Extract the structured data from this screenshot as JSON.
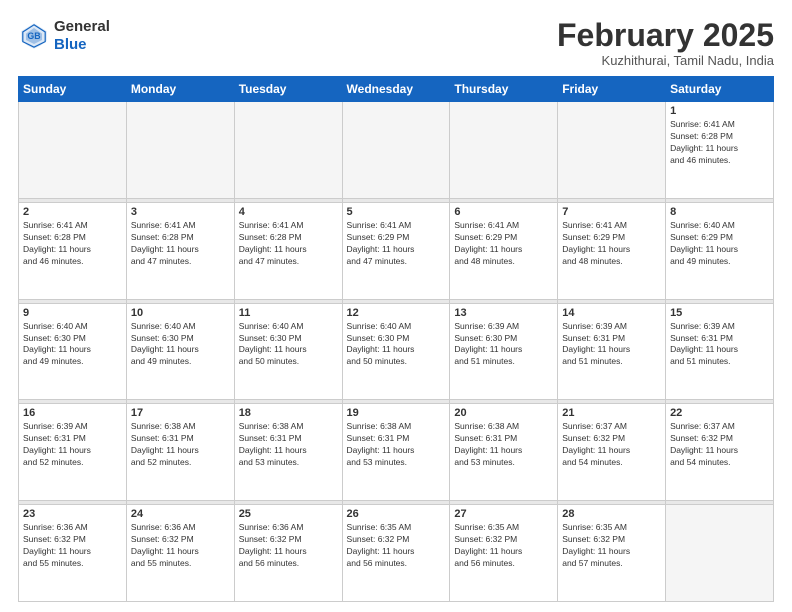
{
  "header": {
    "logo_general": "General",
    "logo_blue": "Blue",
    "title": "February 2025",
    "location": "Kuzhithurai, Tamil Nadu, India"
  },
  "calendar": {
    "days_of_week": [
      "Sunday",
      "Monday",
      "Tuesday",
      "Wednesday",
      "Thursday",
      "Friday",
      "Saturday"
    ],
    "weeks": [
      {
        "days": [
          {
            "num": "",
            "info": "",
            "empty": true
          },
          {
            "num": "",
            "info": "",
            "empty": true
          },
          {
            "num": "",
            "info": "",
            "empty": true
          },
          {
            "num": "",
            "info": "",
            "empty": true
          },
          {
            "num": "",
            "info": "",
            "empty": true
          },
          {
            "num": "",
            "info": "",
            "empty": true
          },
          {
            "num": "1",
            "info": "Sunrise: 6:41 AM\nSunset: 6:28 PM\nDaylight: 11 hours\nand 46 minutes.",
            "empty": false
          }
        ]
      },
      {
        "days": [
          {
            "num": "2",
            "info": "Sunrise: 6:41 AM\nSunset: 6:28 PM\nDaylight: 11 hours\nand 46 minutes.",
            "empty": false
          },
          {
            "num": "3",
            "info": "Sunrise: 6:41 AM\nSunset: 6:28 PM\nDaylight: 11 hours\nand 47 minutes.",
            "empty": false
          },
          {
            "num": "4",
            "info": "Sunrise: 6:41 AM\nSunset: 6:28 PM\nDaylight: 11 hours\nand 47 minutes.",
            "empty": false
          },
          {
            "num": "5",
            "info": "Sunrise: 6:41 AM\nSunset: 6:29 PM\nDaylight: 11 hours\nand 47 minutes.",
            "empty": false
          },
          {
            "num": "6",
            "info": "Sunrise: 6:41 AM\nSunset: 6:29 PM\nDaylight: 11 hours\nand 48 minutes.",
            "empty": false
          },
          {
            "num": "7",
            "info": "Sunrise: 6:41 AM\nSunset: 6:29 PM\nDaylight: 11 hours\nand 48 minutes.",
            "empty": false
          },
          {
            "num": "8",
            "info": "Sunrise: 6:40 AM\nSunset: 6:29 PM\nDaylight: 11 hours\nand 49 minutes.",
            "empty": false
          }
        ]
      },
      {
        "days": [
          {
            "num": "9",
            "info": "Sunrise: 6:40 AM\nSunset: 6:30 PM\nDaylight: 11 hours\nand 49 minutes.",
            "empty": false
          },
          {
            "num": "10",
            "info": "Sunrise: 6:40 AM\nSunset: 6:30 PM\nDaylight: 11 hours\nand 49 minutes.",
            "empty": false
          },
          {
            "num": "11",
            "info": "Sunrise: 6:40 AM\nSunset: 6:30 PM\nDaylight: 11 hours\nand 50 minutes.",
            "empty": false
          },
          {
            "num": "12",
            "info": "Sunrise: 6:40 AM\nSunset: 6:30 PM\nDaylight: 11 hours\nand 50 minutes.",
            "empty": false
          },
          {
            "num": "13",
            "info": "Sunrise: 6:39 AM\nSunset: 6:30 PM\nDaylight: 11 hours\nand 51 minutes.",
            "empty": false
          },
          {
            "num": "14",
            "info": "Sunrise: 6:39 AM\nSunset: 6:31 PM\nDaylight: 11 hours\nand 51 minutes.",
            "empty": false
          },
          {
            "num": "15",
            "info": "Sunrise: 6:39 AM\nSunset: 6:31 PM\nDaylight: 11 hours\nand 51 minutes.",
            "empty": false
          }
        ]
      },
      {
        "days": [
          {
            "num": "16",
            "info": "Sunrise: 6:39 AM\nSunset: 6:31 PM\nDaylight: 11 hours\nand 52 minutes.",
            "empty": false
          },
          {
            "num": "17",
            "info": "Sunrise: 6:38 AM\nSunset: 6:31 PM\nDaylight: 11 hours\nand 52 minutes.",
            "empty": false
          },
          {
            "num": "18",
            "info": "Sunrise: 6:38 AM\nSunset: 6:31 PM\nDaylight: 11 hours\nand 53 minutes.",
            "empty": false
          },
          {
            "num": "19",
            "info": "Sunrise: 6:38 AM\nSunset: 6:31 PM\nDaylight: 11 hours\nand 53 minutes.",
            "empty": false
          },
          {
            "num": "20",
            "info": "Sunrise: 6:38 AM\nSunset: 6:31 PM\nDaylight: 11 hours\nand 53 minutes.",
            "empty": false
          },
          {
            "num": "21",
            "info": "Sunrise: 6:37 AM\nSunset: 6:32 PM\nDaylight: 11 hours\nand 54 minutes.",
            "empty": false
          },
          {
            "num": "22",
            "info": "Sunrise: 6:37 AM\nSunset: 6:32 PM\nDaylight: 11 hours\nand 54 minutes.",
            "empty": false
          }
        ]
      },
      {
        "days": [
          {
            "num": "23",
            "info": "Sunrise: 6:36 AM\nSunset: 6:32 PM\nDaylight: 11 hours\nand 55 minutes.",
            "empty": false
          },
          {
            "num": "24",
            "info": "Sunrise: 6:36 AM\nSunset: 6:32 PM\nDaylight: 11 hours\nand 55 minutes.",
            "empty": false
          },
          {
            "num": "25",
            "info": "Sunrise: 6:36 AM\nSunset: 6:32 PM\nDaylight: 11 hours\nand 56 minutes.",
            "empty": false
          },
          {
            "num": "26",
            "info": "Sunrise: 6:35 AM\nSunset: 6:32 PM\nDaylight: 11 hours\nand 56 minutes.",
            "empty": false
          },
          {
            "num": "27",
            "info": "Sunrise: 6:35 AM\nSunset: 6:32 PM\nDaylight: 11 hours\nand 56 minutes.",
            "empty": false
          },
          {
            "num": "28",
            "info": "Sunrise: 6:35 AM\nSunset: 6:32 PM\nDaylight: 11 hours\nand 57 minutes.",
            "empty": false
          },
          {
            "num": "",
            "info": "",
            "empty": true
          }
        ]
      }
    ]
  }
}
